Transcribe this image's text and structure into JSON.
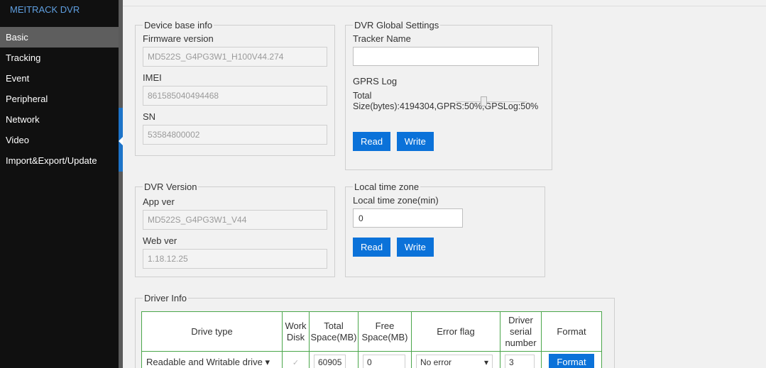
{
  "sidebar": {
    "brand": "MEITRACK DVR",
    "items": [
      {
        "label": "Basic",
        "active": true
      },
      {
        "label": "Tracking"
      },
      {
        "label": "Event"
      },
      {
        "label": "Peripheral"
      },
      {
        "label": "Network"
      },
      {
        "label": "Video"
      },
      {
        "label": "Import&Export/Update"
      }
    ]
  },
  "device_info": {
    "legend": "Device base info",
    "firmware_label": "Firmware version",
    "firmware_value": "MD522S_G4PG3W1_H100V44.274",
    "imei_label": "IMEI",
    "imei_value": "861585040494468",
    "sn_label": "SN",
    "sn_value": "53584800002"
  },
  "global_settings": {
    "legend": "DVR Global Settings",
    "tracker_name_label": "Tracker Name",
    "tracker_name_value": "",
    "gprs_log_label": "GPRS Log",
    "total_size_text": "Total Size(bytes):4194304,GPRS:50%,GPSLog:50%",
    "read_label": "Read",
    "write_label": "Write"
  },
  "dvr_version": {
    "legend": "DVR Version",
    "app_label": "App ver",
    "app_value": "MD522S_G4PG3W1_V44",
    "web_label": "Web ver",
    "web_value": "1.18.12.25"
  },
  "time_zone": {
    "legend": "Local time zone",
    "label": "Local time zone(min)",
    "value": "0",
    "read_label": "Read",
    "write_label": "Write"
  },
  "driver_info": {
    "legend": "Driver Info",
    "headers": [
      "Drive type",
      "Work Disk",
      "Total Space(MB)",
      "Free Space(MB)",
      "Error flag",
      "Driver serial number",
      "Format"
    ],
    "row": {
      "drive_type": "Readable and Writable drive",
      "total": "60905",
      "free": "0",
      "error": "No error",
      "serial": "3",
      "format_label": "Format"
    }
  },
  "colors": {
    "accent": "#0b72d9",
    "table_border": "#4aa64a",
    "sidebar_bg": "#101010",
    "active_item_bg": "#5e5e5e",
    "brand_text": "#5f9fe0"
  }
}
